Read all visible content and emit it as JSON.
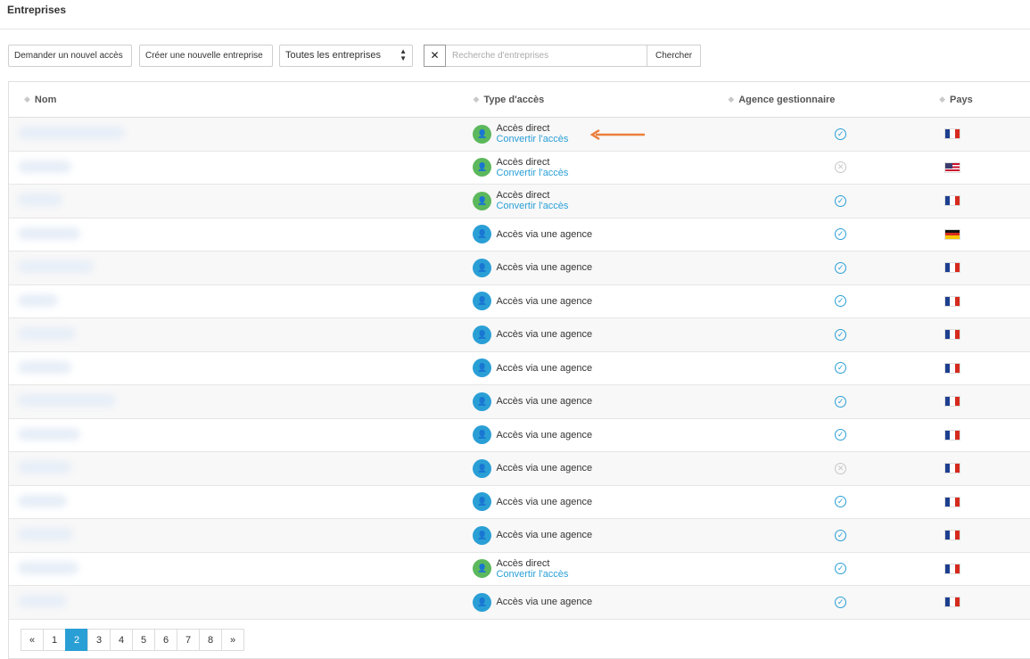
{
  "header": {
    "title": "Entreprises"
  },
  "toolbar": {
    "request_access_label": "Demander un nouvel accès",
    "create_company_label": "Créer une nouvelle entreprise",
    "filter_select_value": "Toutes les entreprises",
    "clear_label": "✕",
    "search_placeholder": "Recherche d'entreprises",
    "search_button_label": "Chercher"
  },
  "table": {
    "columns": {
      "nom": "Nom",
      "type": "Type d'accès",
      "agence": "Agence gestionnaire",
      "pays": "Pays"
    },
    "rows": [
      {
        "type": "direct",
        "type_label": "Accès direct",
        "convert_label": "Convertir l'accès",
        "agence": "check",
        "flag": "fr"
      },
      {
        "type": "direct",
        "type_label": "Accès direct",
        "convert_label": "Convertir l'accès",
        "agence": "cross",
        "flag": "us"
      },
      {
        "type": "direct",
        "type_label": "Accès direct",
        "convert_label": "Convertir l'accès",
        "agence": "check",
        "flag": "fr"
      },
      {
        "type": "agence",
        "type_label": "Accès via une agence",
        "agence": "check",
        "flag": "de"
      },
      {
        "type": "agence",
        "type_label": "Accès via une agence",
        "agence": "check",
        "flag": "fr"
      },
      {
        "type": "agence",
        "type_label": "Accès via une agence",
        "agence": "check",
        "flag": "fr"
      },
      {
        "type": "agence",
        "type_label": "Accès via une agence",
        "agence": "check",
        "flag": "fr"
      },
      {
        "type": "agence",
        "type_label": "Accès via une agence",
        "agence": "check",
        "flag": "fr"
      },
      {
        "type": "agence",
        "type_label": "Accès via une agence",
        "agence": "check",
        "flag": "fr"
      },
      {
        "type": "agence",
        "type_label": "Accès via une agence",
        "agence": "check",
        "flag": "fr"
      },
      {
        "type": "agence",
        "type_label": "Accès via une agence",
        "agence": "cross",
        "flag": "fr"
      },
      {
        "type": "agence",
        "type_label": "Accès via une agence",
        "agence": "check",
        "flag": "fr"
      },
      {
        "type": "agence",
        "type_label": "Accès via une agence",
        "agence": "check",
        "flag": "fr"
      },
      {
        "type": "direct",
        "type_label": "Accès direct",
        "convert_label": "Convertir l'accès",
        "agence": "check",
        "flag": "fr"
      },
      {
        "type": "agence",
        "type_label": "Accès via une agence",
        "agence": "check",
        "flag": "fr"
      }
    ]
  },
  "pagination": {
    "prev": "«",
    "pages": [
      "1",
      "2",
      "3",
      "4",
      "5",
      "6",
      "7",
      "8"
    ],
    "current": "2",
    "next": "»"
  },
  "colors": {
    "accent": "#2a9fd6",
    "direct_green": "#5cb85c",
    "annotation_arrow": "#ec7f3b"
  },
  "icons": {
    "access": "user-icon",
    "check": "check-circle-icon",
    "cross": "x-circle-icon"
  }
}
